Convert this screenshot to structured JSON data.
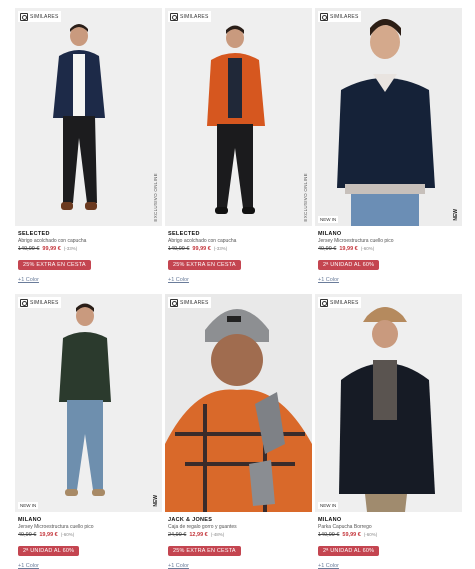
{
  "similares_label": "SIMILARES",
  "products": [
    {
      "brand": "SELECTED",
      "name": "Abrigo acolchado con capucha",
      "old_price": "149,99 €",
      "price": "99,99 €",
      "discount": "(-33%)",
      "promo": "25% EXTRA EN CESTA",
      "colors": "+1 Color",
      "tag": "EXCLUSIVO ONLINE"
    },
    {
      "brand": "SELECTED",
      "name": "Abrigo acolchado con capucha",
      "old_price": "149,99 €",
      "price": "99,99 €",
      "discount": "(-33%)",
      "promo": "25% EXTRA EN CESTA",
      "colors": "+1 Color",
      "tag": "EXCLUSIVO ONLINE"
    },
    {
      "brand": "MILANO",
      "name": "Jersey Microestructura cuello pico",
      "old_price": "49,99 €",
      "price": "19,99 €",
      "discount": "(-60%)",
      "promo": "2ª UNIDAD AL 60%",
      "colors": "+1 Color",
      "new_in": "NEW IN",
      "new_v": "NEW"
    },
    {
      "brand": "MILANO",
      "name": "Jersey Microestructura cuello pico",
      "old_price": "49,99 €",
      "price": "19,99 €",
      "discount": "(-60%)",
      "promo": "2ª UNIDAD AL 60%",
      "colors": "+1 Color",
      "new_in": "NEW IN",
      "new_v": "NEW"
    },
    {
      "brand": "JACK & JONES",
      "name": "Caja de regalo gorro y guantes",
      "old_price": "24,99 €",
      "price": "12,99 €",
      "discount": "(-48%)",
      "promo": "25% EXTRA EN CESTA",
      "colors": "+1 Color"
    },
    {
      "brand": "MILANO",
      "name": "Parka Capucha Borrego",
      "old_price": "149,99 €",
      "price": "59,99 €",
      "discount": "(-60%)",
      "promo": "2ª UNIDAD AL 60%",
      "colors": "+1 Color",
      "new_in": "NEW IN"
    }
  ]
}
